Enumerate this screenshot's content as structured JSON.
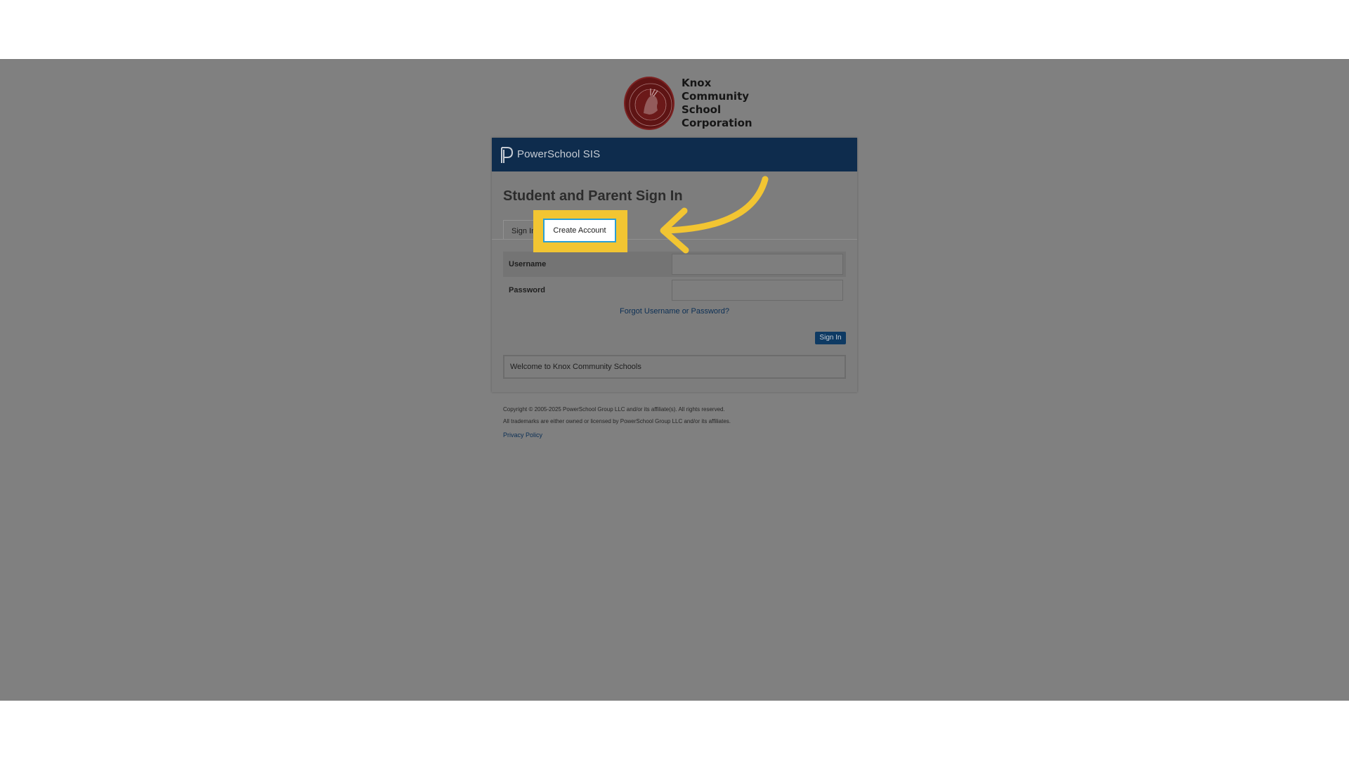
{
  "school": {
    "name_lines": [
      "Knox",
      "Community",
      "School",
      "Corporation"
    ]
  },
  "header": {
    "product": "PowerSchool SIS"
  },
  "page": {
    "title": "Student and Parent Sign In"
  },
  "tabs": {
    "signin_label": "Sign In",
    "create_account_label": "Create Account"
  },
  "form": {
    "username_label": "Username",
    "username_value": "",
    "password_label": "Password",
    "password_value": "",
    "forgot_link": "Forgot Username or Password?",
    "signin_button": "Sign In"
  },
  "welcome": {
    "message": "Welcome to Knox Community Schools"
  },
  "footer": {
    "copyright": "Copyright © 2005-2025 PowerSchool Group LLC and/or its affiliate(s). All rights reserved.",
    "trademarks": "All trademarks are either owned or licensed by PowerSchool Group LLC and/or its affiliates.",
    "privacy_link": "Privacy Policy"
  },
  "colors": {
    "header_bg": "#0e2c4d",
    "highlight": "#f2c532",
    "focus_border": "#2a9fd6",
    "overlay": "#808080"
  },
  "icons": {
    "school_seal": "school-seal-icon",
    "powerschool_logo": "powerschool-logo-icon",
    "callout_arrow": "curved-arrow-icon"
  }
}
